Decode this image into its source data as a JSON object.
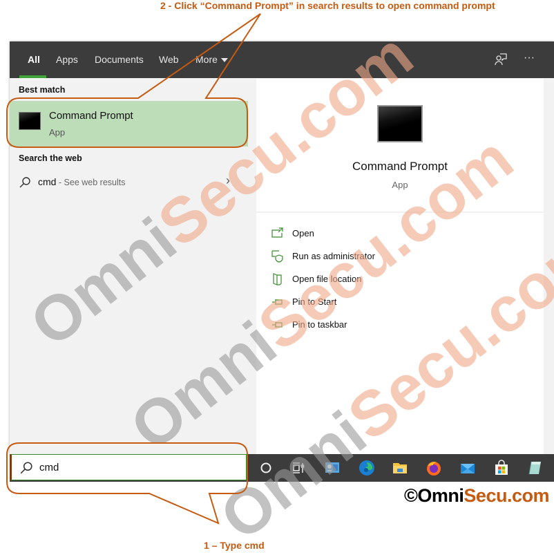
{
  "annotations": {
    "step2": "2 - Click “Command Prompt” in search results to open command prompt",
    "step1": "1 – Type cmd"
  },
  "topbar": {
    "tabs": [
      {
        "label": "All",
        "active": true
      },
      {
        "label": "Apps"
      },
      {
        "label": "Documents"
      },
      {
        "label": "Web"
      },
      {
        "label": "More"
      }
    ],
    "icons": [
      "feedback-icon",
      "more-options-icon"
    ],
    "more_options_glyph": "···"
  },
  "left_panel": {
    "best_match_heading": "Best match",
    "best_match": {
      "title": "Command Prompt",
      "subtitle": "App",
      "icon": "command-prompt-icon"
    },
    "search_web_heading": "Search the web",
    "web_result": {
      "query": "cmd",
      "suffix": " - See web results"
    }
  },
  "detail_panel": {
    "title": "Command Prompt",
    "subtitle": "App",
    "actions": [
      {
        "label": "Open",
        "icon": "open-icon"
      },
      {
        "label": "Run as administrator",
        "icon": "shield-icon"
      },
      {
        "label": "Open file location",
        "icon": "folder-icon"
      },
      {
        "label": "Pin to Start",
        "icon": "pin-icon"
      },
      {
        "label": "Pin to taskbar",
        "icon": "pin-icon"
      }
    ]
  },
  "taskbar": {
    "search_value": "cmd",
    "icons": [
      "cortana-icon",
      "task-view-icon",
      "control-panel-icon",
      "edge-icon",
      "file-explorer-icon",
      "firefox-icon",
      "mail-icon",
      "store-icon",
      "notepad-icon"
    ]
  },
  "copyright": {
    "symbol": "©",
    "part1": "Omni",
    "part2": "Secu.com"
  },
  "watermark": {
    "part1": "Omni",
    "part2": "Secu.com"
  },
  "colors": {
    "accent": "#3fa33a",
    "annotation": "#c55a11",
    "highlight": "#bddcb8",
    "topbar": "#3c3c3c"
  }
}
